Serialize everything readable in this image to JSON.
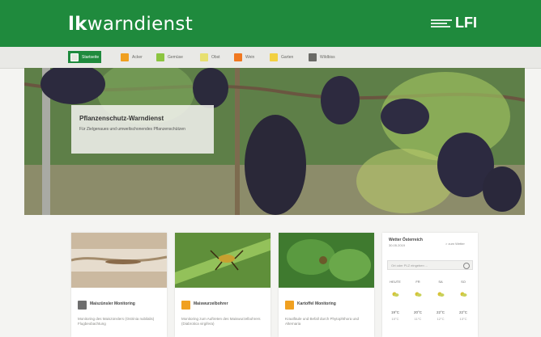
{
  "header": {
    "brand_bold": "lk",
    "brand_rest": "warndienst",
    "partner_logo": "LFI"
  },
  "nav": {
    "items": [
      {
        "label": "Startseite",
        "color": "#1f8a3d",
        "active": true
      },
      {
        "label": "Acker",
        "color": "#f0a020"
      },
      {
        "label": "Gemüse",
        "color": "#8cc540"
      },
      {
        "label": "Obst",
        "color": "#e7e070"
      },
      {
        "label": "Wein",
        "color": "#f07820"
      },
      {
        "label": "Garten",
        "color": "#f2d040"
      },
      {
        "label": "Wildbiss",
        "color": "#6a6a66"
      }
    ]
  },
  "hero": {
    "title": "Pflanzenschutz-Warndienst",
    "subtitle": "Für Zielgenaues und umweltschonendes Pflanzenschützen"
  },
  "cards": [
    {
      "title": "Maiszünsler Monitoring",
      "icon_color": "#6e6e6e",
      "text": "Monitoring des Maiszünslers (Ostrinia nubilalis) Flugbeobachtung"
    },
    {
      "title": "Maiswurzelbohrer",
      "icon_color": "#f0a020",
      "text": "Monitoring zum Auftreten des Maiswurzelbohrers (Diabrotica virgifera)"
    },
    {
      "title": "Kartoffel Monitoring",
      "icon_color": "#f0a020",
      "text": "Krautfäule und Befall durch Phytophthora und Alternaria"
    }
  ],
  "weather": {
    "title": "Wetter Österreich",
    "date": "30.05.2019",
    "link": "> zum Wetter",
    "search_placeholder": "Ort oder PLZ eingeben ...",
    "days": [
      {
        "label": "HEUTE",
        "temp": "19°C",
        "low": "10°C"
      },
      {
        "label": "FR",
        "temp": "20°C",
        "low": "11°C"
      },
      {
        "label": "SA",
        "temp": "22°C",
        "low": "12°C"
      },
      {
        "label": "SO",
        "temp": "22°C",
        "low": "13°C"
      }
    ]
  }
}
